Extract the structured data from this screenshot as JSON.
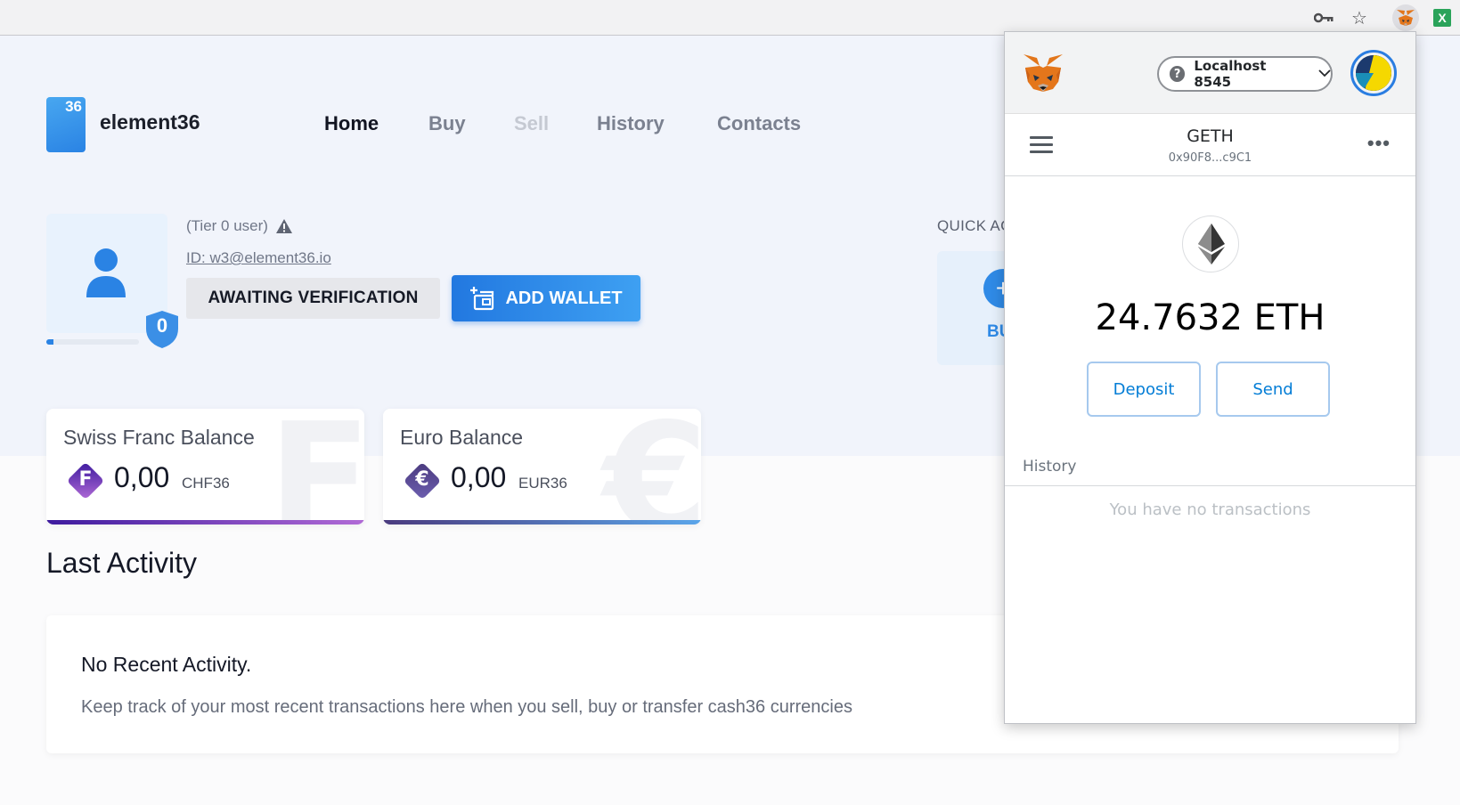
{
  "browser": {
    "icons": [
      "key-icon",
      "star-icon",
      "metamask-extension-icon",
      "excel-extension-icon"
    ],
    "excel_label": "X"
  },
  "app": {
    "logo_number": "36",
    "brand": "element36",
    "nav": [
      {
        "label": "Home",
        "state": "active"
      },
      {
        "label": "Buy",
        "state": "normal"
      },
      {
        "label": "Sell",
        "state": "disabled"
      },
      {
        "label": "History",
        "state": "normal"
      },
      {
        "label": "Contacts",
        "state": "normal"
      }
    ],
    "profile": {
      "tier_text": "(Tier 0 user)",
      "id_text": "ID: w3@element36.io",
      "tier_badge": "0",
      "progress": 0.08,
      "await_label": "AWAITING VERIFICATION",
      "add_wallet_label": "ADD WALLET"
    },
    "quick": {
      "label": "QUICK AC",
      "button_label": "BU",
      "button_icon": "+"
    },
    "balances": [
      {
        "title": "Swiss Franc Balance",
        "coin_glyph": "F",
        "amount": "0,00",
        "currency": "CHF36",
        "bg_glyph": "F"
      },
      {
        "title": "Euro Balance",
        "coin_glyph": "€",
        "amount": "0,00",
        "currency": "EUR36",
        "bg_glyph": "€"
      }
    ],
    "last_activity": {
      "title": "Last Activity",
      "heading": "No Recent Activity.",
      "text": "Keep track of your most recent transactions here when you sell, buy or transfer cash36 currencies"
    }
  },
  "metamask": {
    "network": "Localhost 8545",
    "account_name": "GETH",
    "account_address": "0x90F8...c9C1",
    "balance": "24.7632 ETH",
    "deposit_label": "Deposit",
    "send_label": "Send",
    "history_label": "History",
    "no_tx_text": "You have no transactions"
  },
  "colors": {
    "accent": "#2a83e4",
    "metamask_blue": "#037dd6",
    "chf_gradient": [
      "#3d1a9e",
      "#b06ad6"
    ],
    "eur_gradient": [
      "#4a3a7e",
      "#5aa5ea"
    ]
  }
}
